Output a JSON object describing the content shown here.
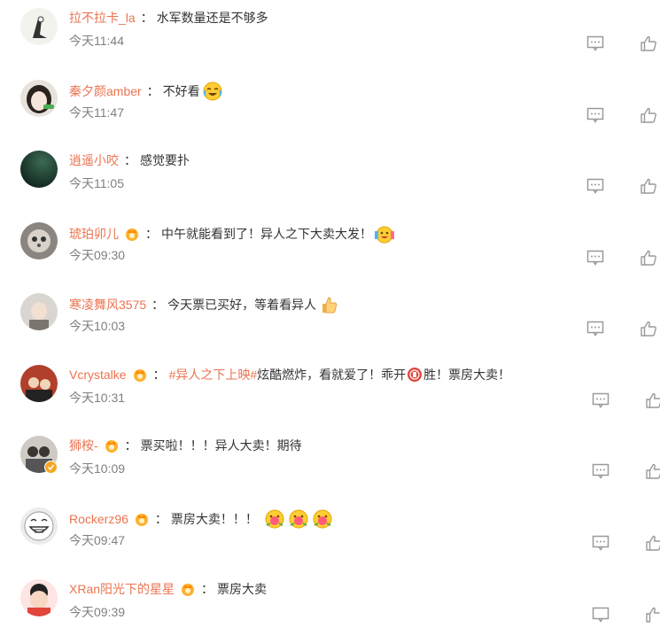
{
  "icons": {
    "reply": "comment-icon",
    "like": "thumbs-up-icon",
    "badge": "crown-badge-icon"
  },
  "colors": {
    "username": "#eb7350",
    "text": "#333333",
    "time": "#808080",
    "icon": "#9a9a9a"
  },
  "comments": [
    {
      "user": "拉不拉卡_la",
      "text": "水军数量还是不够多",
      "time": "今天11:44"
    },
    {
      "user": "秦夕颜amber",
      "text": "不好看",
      "time": "今天11:47"
    },
    {
      "user": "逍遥小咬",
      "text": "感觉要扑",
      "time": "今天11:05"
    },
    {
      "user": "琥珀卯儿",
      "text": "中午就能看到了！异人之下大卖大发！",
      "time": "今天09:30"
    },
    {
      "user": "寒凌舞风3575",
      "text": "今天票已买好，等着看异人",
      "time": "今天10:03"
    },
    {
      "user": "Vcrystalke",
      "topic": "#异人之下上映#",
      "text": " 炫酷燃炸，看就爱了！乖开",
      "text2": "胜！票房大卖！",
      "time": "今天10:31"
    },
    {
      "user": "狮桉-",
      "text": "票买啦！！！异人大卖！期待",
      "time": "今天10:09"
    },
    {
      "user": "Rockerz96",
      "text": "票房大卖！！！",
      "time": "今天09:47"
    },
    {
      "user": "XRan阳光下的星星",
      "text": "票房大卖",
      "time": "今天09:39"
    }
  ]
}
